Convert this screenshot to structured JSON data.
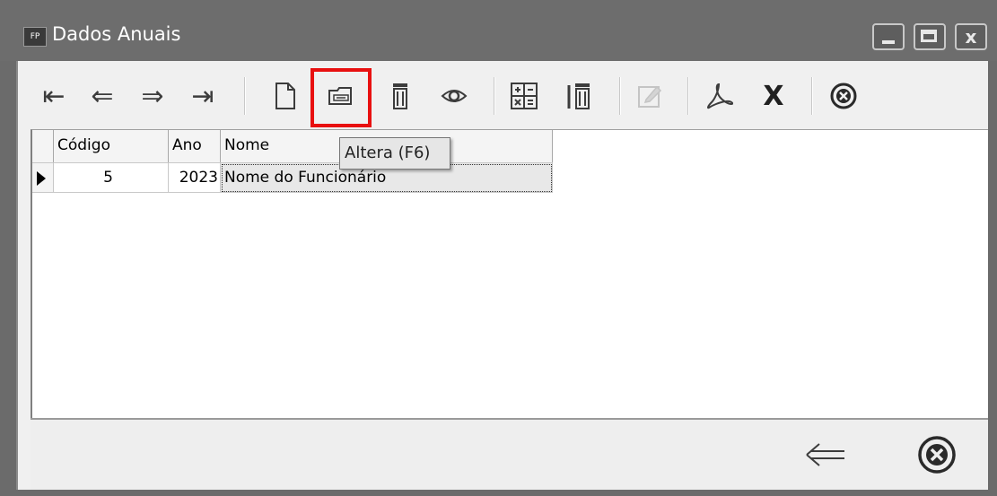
{
  "window": {
    "app_badge": "FP",
    "title": "Dados Anuais",
    "close_symbol": "x"
  },
  "toolbar": {
    "buttons": [
      {
        "name": "first-record",
        "icon": "first-record-icon",
        "glyph": "⇤",
        "enabled": true
      },
      {
        "name": "previous-record",
        "icon": "arrow-left-icon",
        "glyph": "⇐",
        "enabled": true
      },
      {
        "name": "next-record",
        "icon": "arrow-right-icon",
        "glyph": "⇒",
        "enabled": true
      },
      {
        "name": "last-record",
        "icon": "last-record-icon",
        "glyph": "⇥",
        "enabled": true
      },
      {
        "name": "new",
        "icon": "new-document-icon",
        "enabled": true
      },
      {
        "name": "edit",
        "icon": "folder-edit-icon",
        "enabled": true,
        "highlighted": true
      },
      {
        "name": "delete",
        "icon": "trash-icon",
        "enabled": true
      },
      {
        "name": "view",
        "icon": "eye-icon",
        "enabled": true
      },
      {
        "name": "calculator",
        "icon": "calculator-icon",
        "enabled": true
      },
      {
        "name": "delete-all",
        "icon": "trash-bar-icon",
        "enabled": true
      },
      {
        "name": "edit-disabled",
        "icon": "pencil-edit-icon",
        "enabled": false
      },
      {
        "name": "pdf",
        "icon": "pdf-icon",
        "enabled": true
      },
      {
        "name": "excel",
        "icon": "excel-x-icon",
        "glyph": "X",
        "enabled": true
      },
      {
        "name": "close",
        "icon": "close-circle-icon",
        "enabled": true
      }
    ],
    "highlight_color": "#e81010"
  },
  "tooltip": {
    "text": "Altera (F6)"
  },
  "grid": {
    "columns": [
      "Código",
      "Ano",
      "Nome"
    ],
    "rows": [
      {
        "codigo": "5",
        "ano": "2023",
        "nome": "Nome do Funcionário"
      }
    ]
  },
  "bottom": {
    "buttons": [
      {
        "name": "back",
        "icon": "arrow-left-icon"
      },
      {
        "name": "close",
        "icon": "close-circle-icon"
      }
    ]
  }
}
